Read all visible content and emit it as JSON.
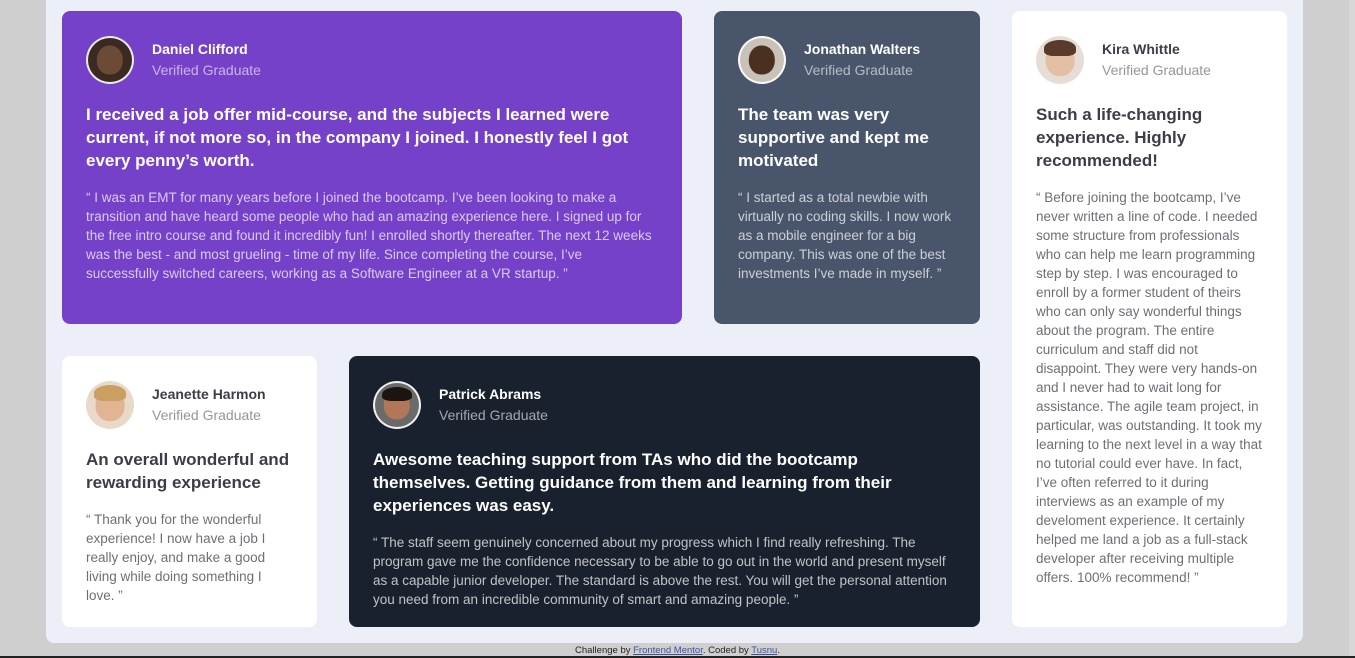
{
  "testimonials": [
    {
      "name": "Daniel Clifford",
      "role": "Verified Graduate",
      "headline": "I received a job offer mid-course, and the subjects I learned were current, if not more so, in the company I joined. I honestly feel I got every penny’s worth.",
      "quote": "“ I was an EMT for many years before I joined the bootcamp. I’ve been looking to make a transition and have heard some people who had an amazing experience here. I signed up for the free intro course and found it incredibly fun! I enrolled shortly thereafter. The next 12 weeks was the best - and most grueling - time of my life. Since completing the course, I’ve successfully switched careers, working as a Software Engineer at a VR startup. ”",
      "background": "#7541c8"
    },
    {
      "name": "Jonathan Walters",
      "role": "Verified Graduate",
      "headline": "The team was very supportive and kept me motivated",
      "quote": "“ I started as a total newbie with virtually no coding skills. I now work as a mobile engineer for a big company. This was one of the best investments I’ve made in myself. ”",
      "background": "#48556a"
    },
    {
      "name": "Jeanette Harmon",
      "role": "Verified Graduate",
      "headline": "An overall wonderful and rewarding experience",
      "quote": "“ Thank you for the wonderful experience! I now have a job I really enjoy, and make a good living while doing something I love. ”",
      "background": "#ffffff"
    },
    {
      "name": "Patrick Abrams",
      "role": "Verified Graduate",
      "headline": "Awesome teaching support from TAs who did the bootcamp themselves. Getting guidance from them and learning from their experiences was easy.",
      "quote": "“ The staff seem genuinely concerned about my progress which I find really refreshing. The program gave me the confidence necessary to be able to go out in the world and present myself as a capable junior developer. The standard is above the rest. You will get the personal attention you need from an incredible community of smart and amazing people. ”",
      "background": "#19212e"
    },
    {
      "name": "Kira Whittle",
      "role": "Verified Graduate",
      "headline": "Such a life-changing experience. Highly recommended!",
      "quote": "“ Before joining the bootcamp, I’ve never written a line of code. I needed some structure from professionals who can help me learn programming step by step. I was encouraged to enroll by a former student of theirs who can only say wonderful things about the program. The entire curriculum and staff did not disappoint. They were very hands-on and I never had to wait long for assistance. The agile team project, in particular, was outstanding. It took my learning to the next level in a way that no tutorial could ever have. In fact, I’ve often referred to it during interviews as an example of my develoment experience. It certainly helped me land a job as a full-stack developer after receiving multiple offers. 100% recommend! ”",
      "background": "#ffffff"
    }
  ],
  "footer": {
    "prefix": "Challenge by ",
    "link1": "Frontend Mentor",
    "middle": ". Coded by ",
    "link2": "Tusnu",
    "suffix": "."
  }
}
